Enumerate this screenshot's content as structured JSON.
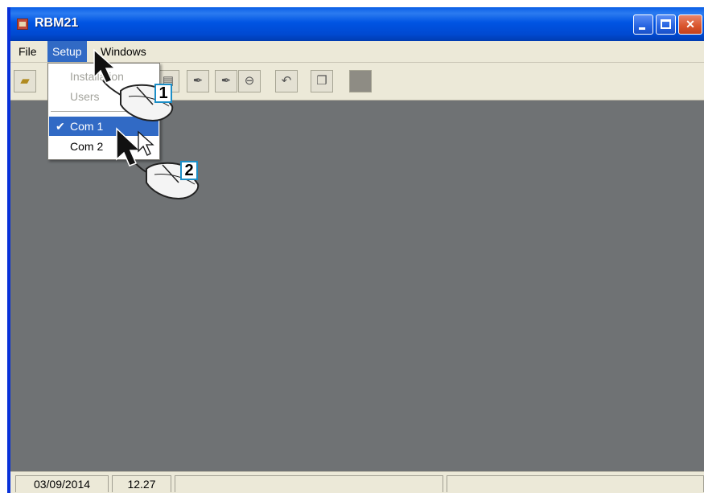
{
  "window": {
    "title": "RBM21",
    "icon": "app-icon",
    "controls": [
      "minimize-icon",
      "maximize-icon",
      "close-icon"
    ]
  },
  "menubar": {
    "items": [
      {
        "label": "File"
      },
      {
        "label": "Setup"
      },
      {
        "label": "Windows"
      }
    ]
  },
  "setup_menu": {
    "items": [
      {
        "label": "Installation",
        "enabled": false
      },
      {
        "label": "Users",
        "enabled": false
      },
      {
        "label": "Com 1",
        "checked": true,
        "highlighted": true
      },
      {
        "label": "Com 2",
        "checked": false
      }
    ],
    "check_glyph": "✔"
  },
  "toolbar": {
    "icons": [
      "open-folder-icon",
      "pin-icon",
      "pin-icon",
      "stop-icon",
      "undo-icon",
      "copy-icon",
      "square-icon"
    ]
  },
  "statusbar": {
    "date": "03/09/2014",
    "time": "12.27"
  },
  "callouts": {
    "step1": "1",
    "step2": "2"
  },
  "colors": {
    "titlebar": "#0054e3",
    "menu_highlight": "#316ac5",
    "client_bg": "#6f7274",
    "callout_border": "#1b8ec7"
  }
}
